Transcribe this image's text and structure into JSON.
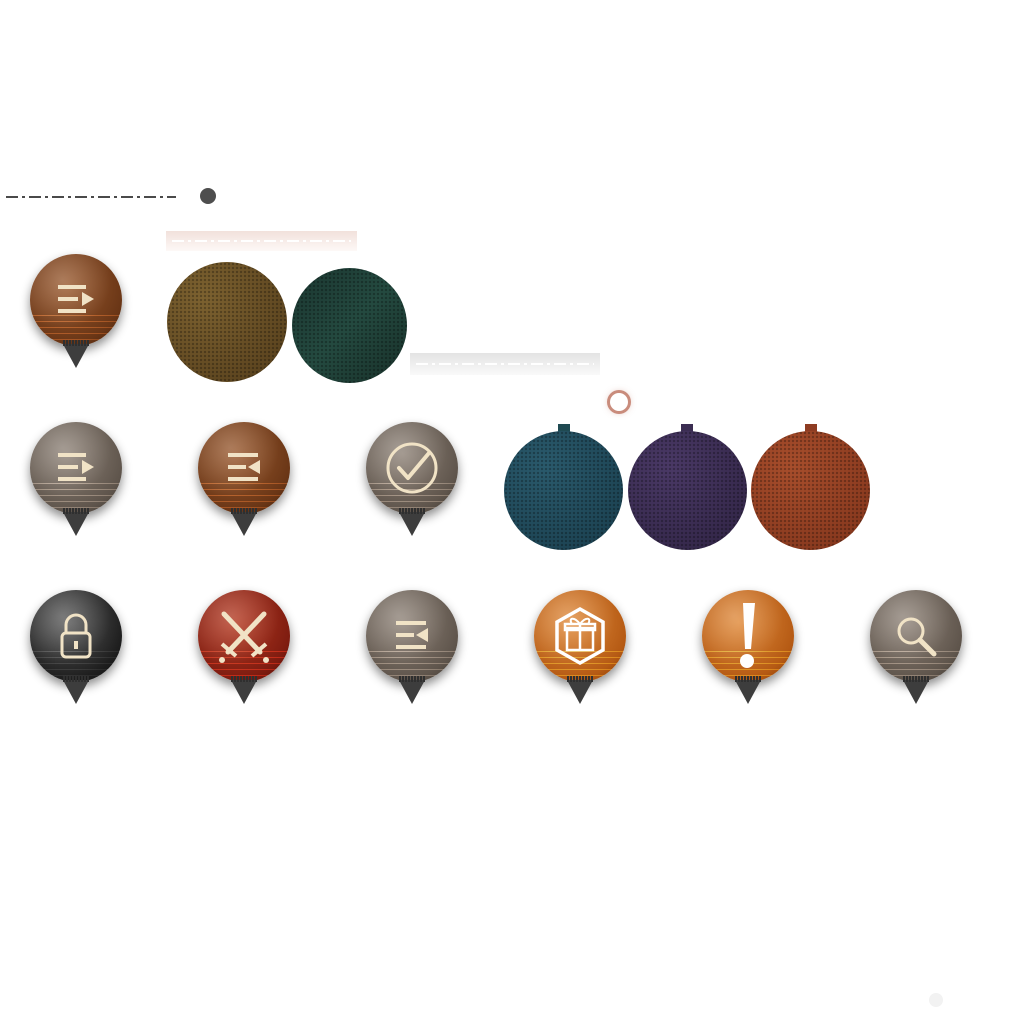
{
  "title": "",
  "colors": {
    "brown": "#7a4420",
    "grey": "#6b6157",
    "black": "#1e1e1e",
    "red": "#8e2414",
    "orange": "#c96a1e",
    "icon_cream": "#f1e3c6",
    "swatch_olive": "#6b5226",
    "swatch_teal_dark": "#1f3a34",
    "swatch_teal": "#20485a",
    "swatch_purple": "#3b2d52",
    "swatch_rust": "#8e3c22"
  },
  "markers": [
    {
      "id": "quest-turn-in-brown",
      "color": "brown",
      "icon": "list-arrow-right-icon"
    },
    {
      "id": "quest-turn-in-grey",
      "color": "grey",
      "icon": "list-arrow-right-icon"
    },
    {
      "id": "quest-accept-brown",
      "color": "brown",
      "icon": "list-arrow-left-icon"
    },
    {
      "id": "quest-complete-grey",
      "color": "grey",
      "icon": "checkmark-circle-icon"
    },
    {
      "id": "locked-black",
      "color": "black",
      "icon": "padlock-icon"
    },
    {
      "id": "battle-red",
      "color": "red",
      "icon": "crossed-swords-icon"
    },
    {
      "id": "quest-accept-grey",
      "color": "grey",
      "icon": "list-arrow-left-icon"
    },
    {
      "id": "reward-orange",
      "color": "orange",
      "icon": "gift-box-icon"
    },
    {
      "id": "alert-orange",
      "color": "orange",
      "icon": "exclamation-icon"
    },
    {
      "id": "search-grey",
      "color": "grey",
      "icon": "magnifier-icon"
    }
  ],
  "swatches": [
    {
      "id": "olive-texture",
      "color": "swatch_olive"
    },
    {
      "id": "dark-teal-texture",
      "color": "swatch_teal_dark"
    },
    {
      "id": "teal-texture",
      "color": "swatch_teal"
    },
    {
      "id": "purple-texture",
      "color": "swatch_purple"
    },
    {
      "id": "rust-texture",
      "color": "swatch_rust"
    }
  ]
}
